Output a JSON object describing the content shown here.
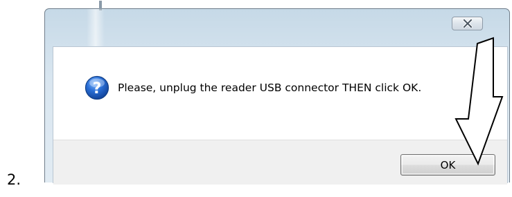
{
  "step": {
    "label": "2."
  },
  "dialog": {
    "close_glyph": "✕",
    "message": "Please, unplug the reader USB connector THEN click OK.",
    "icon": "question-icon",
    "ok_label": "OK"
  },
  "annotation": {
    "icon": "down-arrow-icon",
    "color": "#000000"
  }
}
